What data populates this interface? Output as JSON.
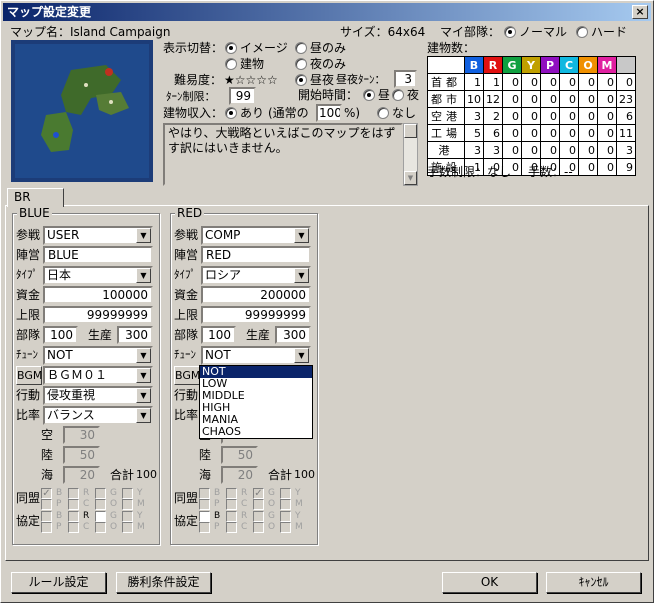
{
  "window": {
    "title": "マップ設定変更",
    "close": "×"
  },
  "map": {
    "name_label": "マップ名：Island Campaign",
    "size": "サイズ：64x64"
  },
  "my_unit": {
    "label": "マイ部隊：",
    "options": [
      "ノーマル",
      "ハード"
    ],
    "selected": 0
  },
  "display": {
    "label": "表示切替：",
    "options": [
      "イメージ",
      "昼のみ",
      "建物",
      "夜のみ"
    ],
    "selected": 0
  },
  "difficulty": {
    "label": "難易度：",
    "stars": "★☆☆☆☆",
    "daynight_label": "昼夜",
    "daynight_turn_label": "昼夜ﾀｰﾝ：",
    "daynight_turn": "3"
  },
  "turn_limit": {
    "label": "ﾀｰﾝ制限：",
    "value": "99"
  },
  "start_time": {
    "label": "開始時間：",
    "options": [
      "昼",
      "夜"
    ],
    "selected": 0
  },
  "income": {
    "label": "建物収入：",
    "on": "あり",
    "normal_prefix": "(通常の",
    "percent": "100",
    "normal_suffix": "%)",
    "off": "なし"
  },
  "description": "やはり、大戦略といえばこのマップをはずす訳にはいきません。",
  "buildings": {
    "label": "建物数：",
    "columns": [
      "B",
      "R",
      "G",
      "Y",
      "P",
      "C",
      "O",
      "M",
      ""
    ],
    "column_colors": [
      "#1060e0",
      "#e01010",
      "#10a040",
      "#c0a000",
      "#9010c0",
      "#10b8e0",
      "#f09000",
      "#e020a0",
      "#c8c8c8"
    ],
    "rows": [
      {
        "label": "首都",
        "values": [
          "1",
          "1",
          "0",
          "0",
          "0",
          "0",
          "0",
          "0",
          "0"
        ]
      },
      {
        "label": "都市",
        "values": [
          "10",
          "12",
          "0",
          "0",
          "0",
          "0",
          "0",
          "0",
          "23"
        ]
      },
      {
        "label": "空港",
        "values": [
          "3",
          "2",
          "0",
          "0",
          "0",
          "0",
          "0",
          "0",
          "6"
        ]
      },
      {
        "label": "工場",
        "values": [
          "5",
          "6",
          "0",
          "0",
          "0",
          "0",
          "0",
          "0",
          "11"
        ]
      },
      {
        "label": "港",
        "values": [
          "3",
          "3",
          "0",
          "0",
          "0",
          "0",
          "0",
          "0",
          "3"
        ]
      },
      {
        "label": "施設",
        "values": [
          "1",
          "0",
          "0",
          "0",
          "0",
          "0",
          "0",
          "0",
          "9"
        ]
      }
    ]
  },
  "moves": {
    "limit": "手数制限：なし",
    "count": "手数：--"
  },
  "tab": "BR",
  "labels": {
    "join": "参戦",
    "camp": "陣営",
    "type": "ﾀｲﾌﾟ",
    "funds": "資金",
    "cap": "上限",
    "units": "部隊",
    "prod": "生産",
    "tune": "ﾁｭｰﾝ",
    "bgm": "BGM",
    "action": "行動",
    "ratio": "比率",
    "air": "空",
    "land": "陸",
    "sea": "海",
    "total": "合計",
    "alliance": "同盟",
    "pact": "協定",
    "ally_letters": [
      "B",
      "P",
      "R",
      "C",
      "G",
      "O",
      "Y",
      "M"
    ]
  },
  "panels": [
    {
      "title": "BLUE",
      "join": "USER",
      "camp": "BLUE",
      "type": "日本",
      "funds": "100000",
      "cap": "99999999",
      "units": "100",
      "prod": "300",
      "tune": "NOT",
      "bgm": "ＢＧＭ０１",
      "action": "侵攻重視",
      "ratio": "バランス",
      "air": "30",
      "land": "50",
      "sea": "20",
      "total": "100",
      "alliance_checked": [
        0
      ],
      "pact_white": [
        2
      ]
    },
    {
      "title": "RED",
      "join": "COMP",
      "camp": "RED",
      "type": "ロシア",
      "funds": "200000",
      "cap": "99999999",
      "units": "100",
      "prod": "300",
      "tune": "NOT",
      "bgm": "",
      "action": "",
      "ratio": "",
      "air": "",
      "land": "50",
      "sea": "20",
      "total": "100",
      "alliance_checked": [
        2
      ],
      "pact_white": [
        0
      ]
    }
  ],
  "tune_dropdown": {
    "options": [
      "NOT",
      "LOW",
      "MIDDLE",
      "HIGH",
      "MANIA",
      "CHAOS"
    ],
    "selected": 0
  },
  "buttons": {
    "rules": "ルール設定",
    "victory": "勝利条件設定",
    "ok": "OK",
    "cancel": "ｷｬﾝｾﾙ"
  }
}
